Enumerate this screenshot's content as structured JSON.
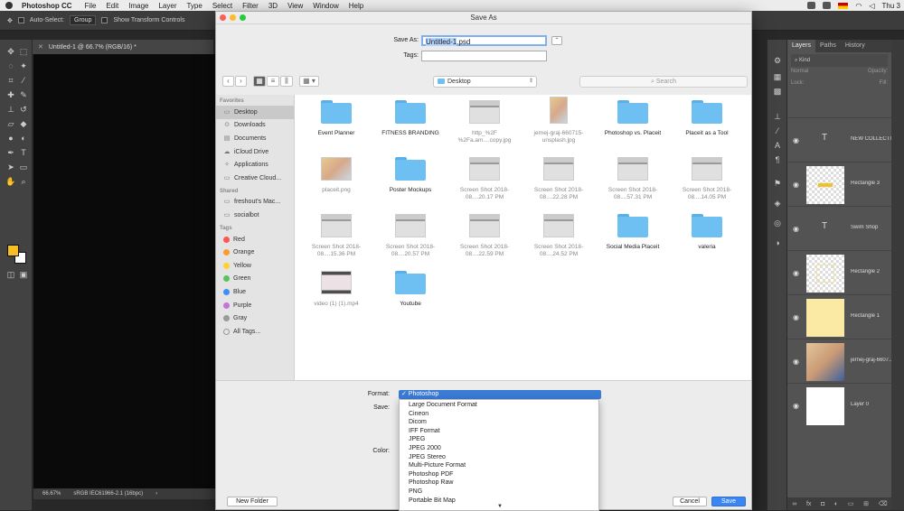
{
  "menubar": {
    "app_name": "Photoshop CC",
    "items": [
      "File",
      "Edit",
      "Image",
      "Layer",
      "Type",
      "Select",
      "Filter",
      "3D",
      "View",
      "Window",
      "Help"
    ],
    "clock": "Thu 3"
  },
  "options_bar": {
    "auto_select_label": "Auto-Select:",
    "auto_select_value": "Group",
    "transform_label": "Show Transform Controls"
  },
  "document": {
    "tab_title": "Untitled-1 @ 66.7% (RGB/16) *",
    "zoom": "66.67%",
    "profile": "sRGB IEC61966-2.1 (16bpc)"
  },
  "colors": {
    "foreground": "#f6bf26",
    "background": "#ffffff",
    "accent": "#3a86f5"
  },
  "layers_panel": {
    "tabs": [
      "Layers",
      "Paths",
      "History"
    ],
    "filter": "Kind",
    "blend": "Normal",
    "opacity_label": "Opacity:",
    "lock_label": "Lock:",
    "fill_label": "Fill:",
    "layers": [
      {
        "name": "NEW COLLECTI..."
      },
      {
        "name": "Rectangle 3"
      },
      {
        "name": "Swim Shop"
      },
      {
        "name": "Rectangle 2"
      },
      {
        "name": "Rectangle 1"
      },
      {
        "name": "jernej-graj-6607..."
      },
      {
        "name": "Layer 0"
      }
    ]
  },
  "dialog": {
    "title": "Save As",
    "save_as_label": "Save As:",
    "file_name": "Untitled-1",
    "file_ext": ".psd",
    "tags_label": "Tags:",
    "location": "Desktop",
    "search_placeholder": "Search",
    "sidebar": {
      "favorites_header": "Favorites",
      "favorites": [
        "Desktop",
        "Downloads",
        "Documents",
        "iCloud Drive",
        "Applications",
        "Creative Cloud..."
      ],
      "shared_header": "Shared",
      "shared": [
        "freshout's Mac...",
        "socialbot"
      ],
      "tags_header": "Tags",
      "tags": [
        {
          "label": "Red",
          "color": "#fc5753"
        },
        {
          "label": "Orange",
          "color": "#fd9a2a"
        },
        {
          "label": "Yellow",
          "color": "#fdd033"
        },
        {
          "label": "Green",
          "color": "#5ac35a"
        },
        {
          "label": "Blue",
          "color": "#3c8ff8"
        },
        {
          "label": "Purple",
          "color": "#c174d8"
        },
        {
          "label": "Gray",
          "color": "#9a9a9a"
        }
      ],
      "all_tags": "All Tags..."
    },
    "files": [
      {
        "label": "Event Planner",
        "kind": "folder"
      },
      {
        "label": "FITNESS BRANDING",
        "kind": "folder"
      },
      {
        "label": "http_%2F %2Fa.am....copy.jpg",
        "kind": "shot"
      },
      {
        "label": "jernej-graj-660715- unsplash.jpg",
        "kind": "photo-tall"
      },
      {
        "label": "Photoshop vs. Placeit",
        "kind": "folder"
      },
      {
        "label": "Placeit as a Tool",
        "kind": "folder"
      },
      {
        "label": "placeit.png",
        "kind": "photo"
      },
      {
        "label": "Poster Mockups",
        "kind": "folder"
      },
      {
        "label": "Screen Shot 2018-08....20.17 PM",
        "kind": "shot"
      },
      {
        "label": "Screen Shot 2018-08....22.28 PM",
        "kind": "shot"
      },
      {
        "label": "Screen Shot 2018-08....57.31 PM",
        "kind": "shot"
      },
      {
        "label": "Screen Shot 2018-08....14.05 PM",
        "kind": "shot"
      },
      {
        "label": "Screen Shot 2018-08....15.36 PM",
        "kind": "shot"
      },
      {
        "label": "Screen Shot 2018-08....20.57 PM",
        "kind": "shot"
      },
      {
        "label": "Screen Shot 2018-08....22.59 PM",
        "kind": "shot"
      },
      {
        "label": "Screen Shot 2018-08....24.52 PM",
        "kind": "shot"
      },
      {
        "label": "Social Media Placeit",
        "kind": "folder"
      },
      {
        "label": "valeria",
        "kind": "folder"
      },
      {
        "label": "video (1) (1).mp4",
        "kind": "mp4"
      },
      {
        "label": "Youtube",
        "kind": "folder"
      }
    ],
    "format_label": "Format:",
    "save_label": "Save:",
    "color_label": "Color:",
    "format_selected": "✓ Photoshop",
    "format_options": [
      "Large Document Format",
      "Cineon",
      "Dicom",
      "IFF Format",
      "JPEG",
      "JPEG 2000",
      "JPEG Stereo",
      "Multi-Picture Format",
      "Photoshop PDF",
      "Photoshop Raw",
      "PNG",
      "Portable Bit Map"
    ],
    "new_folder_button": "New Folder",
    "cancel_button": "Cancel",
    "save_button": "Save"
  }
}
